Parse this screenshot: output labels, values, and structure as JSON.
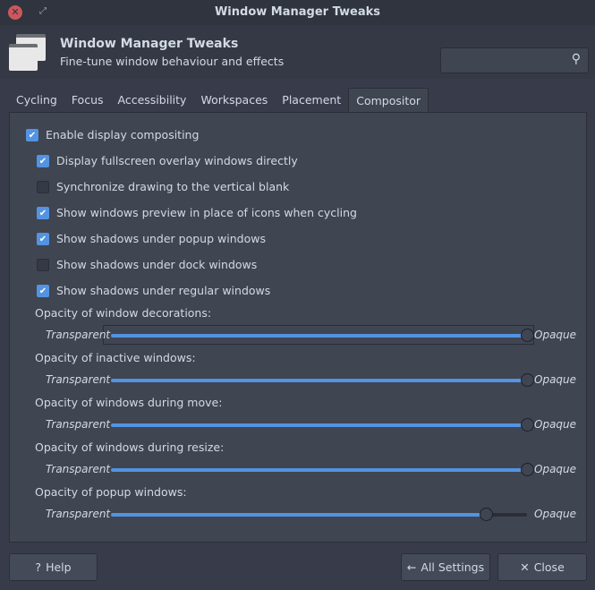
{
  "window": {
    "title": "Window Manager Tweaks"
  },
  "header": {
    "title": "Window Manager Tweaks",
    "subtitle": "Fine-tune window behaviour and effects",
    "search_placeholder": ""
  },
  "tabs": [
    {
      "label": "Cycling"
    },
    {
      "label": "Focus"
    },
    {
      "label": "Accessibility"
    },
    {
      "label": "Workspaces"
    },
    {
      "label": "Placement"
    },
    {
      "label": "Compositor",
      "active": true
    }
  ],
  "compositor": {
    "enable": {
      "label": "Enable display compositing",
      "checked": true
    },
    "options": [
      {
        "label": "Display fullscreen overlay windows directly",
        "checked": true
      },
      {
        "label": "Synchronize drawing to the vertical blank",
        "checked": false
      },
      {
        "label": "Show windows preview in place of icons when cycling",
        "checked": true
      },
      {
        "label": "Show shadows under popup windows",
        "checked": true
      },
      {
        "label": "Show shadows under dock windows",
        "checked": false
      },
      {
        "label": "Show shadows under regular windows",
        "checked": true
      }
    ],
    "min_label": "Transparent",
    "max_label": "Opaque",
    "sliders": [
      {
        "label": "Opacity of window decorations:",
        "value": 1.0
      },
      {
        "label": "Opacity of inactive windows:",
        "value": 1.0
      },
      {
        "label": "Opacity of windows during move:",
        "value": 1.0
      },
      {
        "label": "Opacity of windows during resize:",
        "value": 1.0
      },
      {
        "label": "Opacity of popup windows:",
        "value": 0.9
      }
    ]
  },
  "footer": {
    "help": "Help",
    "all_settings": "All Settings",
    "close": "Close"
  },
  "colors": {
    "accent": "#5294e2",
    "close": "#cc575d"
  }
}
